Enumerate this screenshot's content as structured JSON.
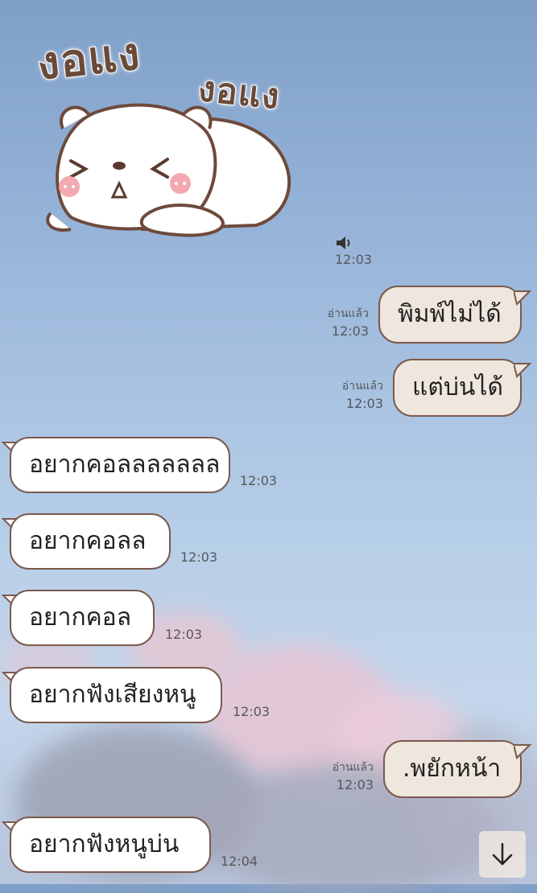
{
  "sticker": {
    "caption_1": "งอแง",
    "caption_2": "งอแง"
  },
  "voice_message": {
    "icon": "speaker-icon",
    "time": "12:03"
  },
  "messages": [
    {
      "dir": "out",
      "text": "พิมพ์ไม่ได้",
      "read": "อ่านแล้ว",
      "time": "12:03"
    },
    {
      "dir": "out",
      "text": "แต่บ่นได้",
      "read": "อ่านแล้ว",
      "time": "12:03"
    },
    {
      "dir": "in",
      "text": "อยากคอลลลลลลล",
      "time": "12:03"
    },
    {
      "dir": "in",
      "text": "อยากคอลล",
      "time": "12:03"
    },
    {
      "dir": "in",
      "text": "อยากคอล",
      "time": "12:03"
    },
    {
      "dir": "in",
      "text": "อยากฟังเสียงหนู",
      "time": "12:03"
    },
    {
      "dir": "out",
      "text": ".พยักหน้า",
      "read": "อ่านแล้ว",
      "time": "12:03"
    },
    {
      "dir": "in",
      "text": "อยากฟังหนูบ่น",
      "time": "12:04"
    }
  ],
  "scroll_button": {
    "icon": "arrow-down-icon"
  },
  "colors": {
    "bubble_border": "#7a5a4d",
    "outgoing_bubble": "#efe6dd",
    "incoming_bubble": "#ffffff"
  }
}
